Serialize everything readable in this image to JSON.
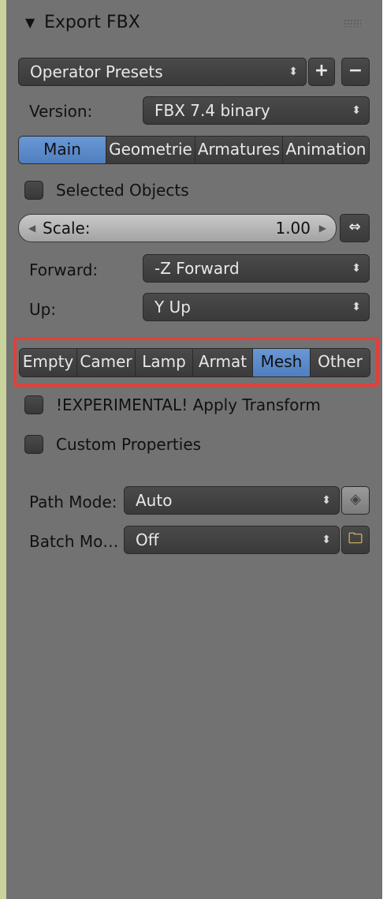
{
  "header": {
    "title": "Export FBX"
  },
  "presets": {
    "label": "Operator Presets",
    "add_icon": "plus-icon",
    "remove_icon": "minus-icon"
  },
  "version": {
    "label": "Version:",
    "value": "FBX 7.4 binary"
  },
  "main_tabs": [
    {
      "label": "Main",
      "active": true
    },
    {
      "label": "Geometrie",
      "active": false
    },
    {
      "label": "Armatures",
      "active": false
    },
    {
      "label": "Animation",
      "active": false
    }
  ],
  "selected_objects": {
    "label": "Selected Objects",
    "checked": false
  },
  "scale": {
    "label": "Scale:",
    "value": "1.00"
  },
  "forward": {
    "label": "Forward:",
    "value": "-Z Forward"
  },
  "up": {
    "label": "Up:",
    "value": "Y Up"
  },
  "object_types": [
    {
      "label": "Empty",
      "active": false
    },
    {
      "label": "Camer",
      "active": false
    },
    {
      "label": "Lamp",
      "active": false
    },
    {
      "label": "Armat",
      "active": false
    },
    {
      "label": "Mesh",
      "active": true
    },
    {
      "label": "Other",
      "active": false
    }
  ],
  "apply_transform": {
    "label": "!EXPERIMENTAL! Apply Transform",
    "checked": false
  },
  "custom_properties": {
    "label": "Custom Properties",
    "checked": false
  },
  "path_mode": {
    "label": "Path Mode:",
    "value": "Auto"
  },
  "batch_mode": {
    "label": "Batch Mo…",
    "value": "Off"
  },
  "colors": {
    "accent": "#5a8acb",
    "highlight": "#e2403b",
    "panel": "#727272"
  }
}
